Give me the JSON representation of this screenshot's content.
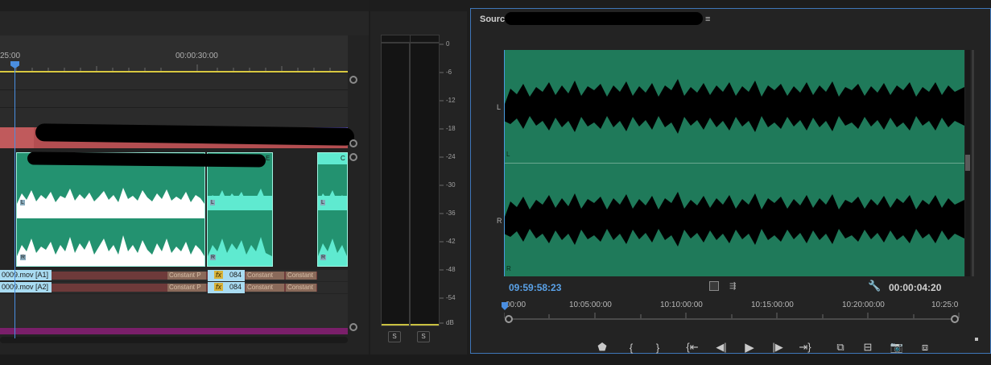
{
  "timeline": {
    "ruler_left": "25:00",
    "ruler_mid": "00:00:30:00",
    "clip_labels": {
      "a1": "0009.mov [A1]",
      "a2": "0009.mov [A2]",
      "fx": "fx",
      "num_a1": "084",
      "num_a2": "084",
      "trans1": "Constant P",
      "trans2": "Constant",
      "trans3": "Constant",
      "trans4": "Constant P",
      "trans5": "Constant",
      "trans6": "Constant",
      "clip_e": "E",
      "clip_c": "C",
      "ch_l1": "L",
      "ch_r1": "R",
      "ch_l2": "L",
      "ch_r2": "R",
      "ch_l3": "L",
      "ch_r3": "R"
    }
  },
  "meter": {
    "scale": [
      "0",
      "-6",
      "-12",
      "-18",
      "-24",
      "-30",
      "-36",
      "-42",
      "-48",
      "-54",
      "dB"
    ],
    "solo_left": "S",
    "solo_right": "S"
  },
  "source": {
    "title": "Source:",
    "menu_icon": "hamburger-icon",
    "channel_l": "L",
    "channel_r": "R",
    "channel_l_small": "L",
    "channel_r_small": "R",
    "timecode_in": "09:59:58:23",
    "timecode_dur": "00:00:04:20",
    "ruler": [
      "00:00",
      "10:05:00:00",
      "10:10:00:00",
      "10:15:00:00",
      "10:20:00:00",
      "10:25:0"
    ],
    "controls": [
      "marker-icon",
      "mark-in-icon",
      "mark-out-icon",
      "go-to-in-icon",
      "step-back-icon",
      "play-icon",
      "step-forward-icon",
      "go-to-out-icon",
      "insert-icon",
      "overwrite-icon",
      "export-frame-icon",
      "button-editor-icon"
    ],
    "colors": {
      "waveform_bg": "#1f7a5a",
      "accent": "#4a9be0"
    }
  }
}
